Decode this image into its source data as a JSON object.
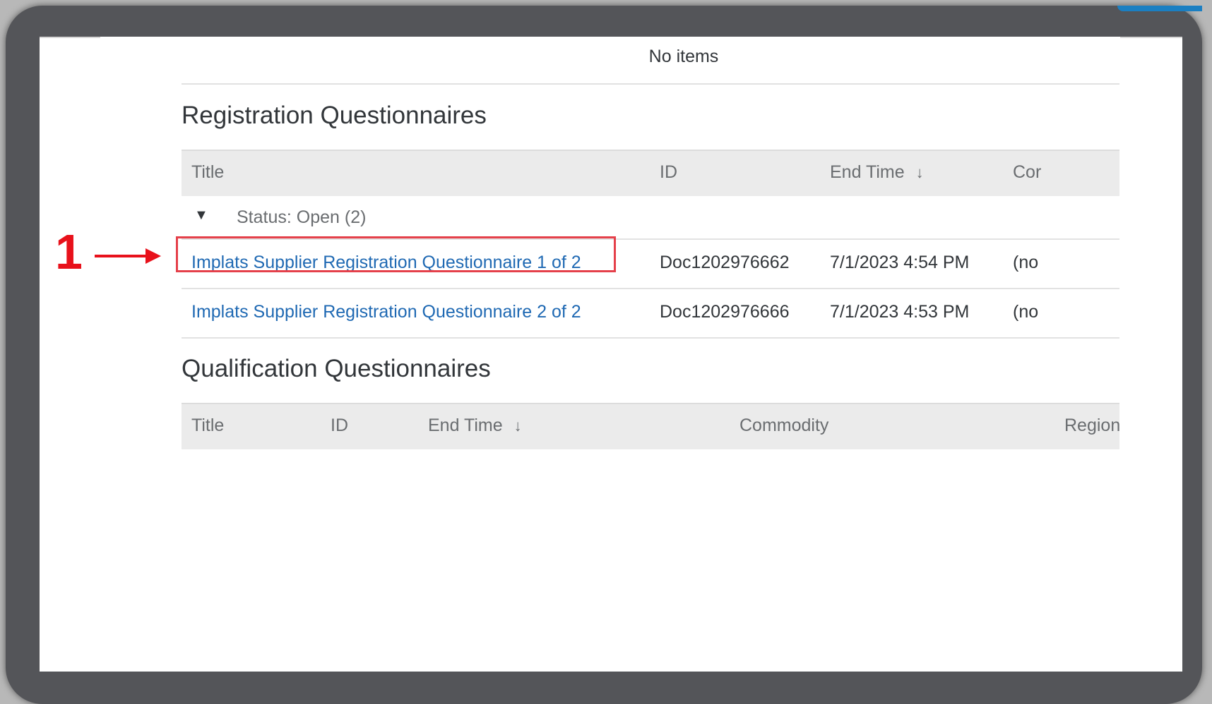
{
  "top": {
    "no_items": "No items"
  },
  "registration": {
    "title": "Registration Questionnaires",
    "columns": {
      "title": "Title",
      "id": "ID",
      "end_time": "End Time",
      "commodity": "Cor"
    },
    "group": {
      "label": "Status: Open  (2)"
    },
    "rows": [
      {
        "title": "Implats Supplier Registration Questionnaire 1 of 2",
        "id": "Doc1202976662",
        "end_time": "7/1/2023 4:54 PM",
        "commodity": "(no"
      },
      {
        "title": "Implats Supplier Registration Questionnaire 2 of 2",
        "id": "Doc1202976666",
        "end_time": "7/1/2023 4:53 PM",
        "commodity": "(no"
      }
    ]
  },
  "qualification": {
    "title": "Qualification Questionnaires",
    "columns": {
      "title": "Title",
      "id": "ID",
      "end_time": "End Time",
      "commodity": "Commodity",
      "regions": "Regions"
    }
  },
  "annotation": {
    "number": "1",
    "color": "#e8111b"
  },
  "colors": {
    "link": "#1f69b3",
    "frame": "#545559",
    "highlight": "#e5404a"
  }
}
